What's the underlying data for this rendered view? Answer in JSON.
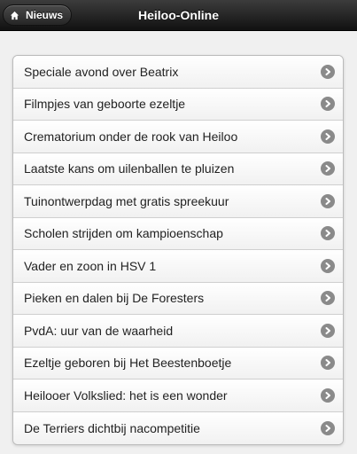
{
  "header": {
    "back_label": "Nieuws",
    "back_icon": "home-icon",
    "title": "Heiloo-Online"
  },
  "list": {
    "items": [
      {
        "label": "Speciale avond over Beatrix"
      },
      {
        "label": "Filmpjes van geboorte ezeltje"
      },
      {
        "label": "Crematorium onder de rook van Heiloo"
      },
      {
        "label": "Laatste kans om uilenballen te pluizen"
      },
      {
        "label": "Tuinontwerpdag met gratis spreekuur"
      },
      {
        "label": "Scholen strijden om kampioenschap"
      },
      {
        "label": "Vader en zoon in HSV 1"
      },
      {
        "label": "Pieken en dalen bij De Foresters"
      },
      {
        "label": "PvdA: uur van de waarheid"
      },
      {
        "label": "Ezeltje geboren bij Het Beestenboetje"
      },
      {
        "label": "Heilooer Volkslied: het is een wonder"
      },
      {
        "label": "De Terriers dichtbij nacompetitie"
      }
    ],
    "item_icon": "chevron-right-icon"
  },
  "colors": {
    "header_background": "#1f1f1f",
    "page_background": "#f0f0f0",
    "arrow_icon": "#8a8a8a"
  }
}
